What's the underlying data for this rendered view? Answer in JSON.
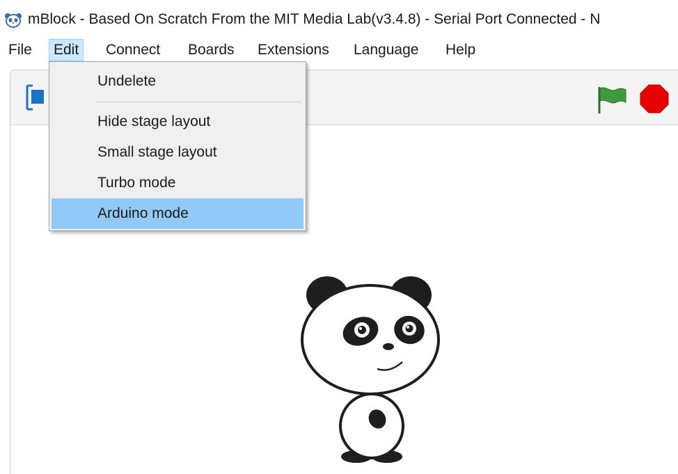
{
  "window": {
    "title": "mBlock - Based On Scratch From the MIT Media Lab(v3.4.8) - Serial Port Connected - N"
  },
  "menubar": {
    "items": [
      {
        "label": "File"
      },
      {
        "label": "Edit"
      },
      {
        "label": "Connect"
      },
      {
        "label": "Boards"
      },
      {
        "label": "Extensions"
      },
      {
        "label": "Language"
      },
      {
        "label": "Help"
      }
    ],
    "open_menu": "Edit"
  },
  "edit_menu": {
    "items": [
      {
        "label": "Undelete"
      },
      {
        "label": "Hide stage layout"
      },
      {
        "label": "Small stage layout"
      },
      {
        "label": "Turbo mode"
      },
      {
        "label": "Arduino mode"
      }
    ],
    "highlighted": "Arduino mode"
  },
  "toolbar": {
    "icons": [
      "stage-layout-toggle-icon",
      "green-flag-icon",
      "stop-sign-icon"
    ]
  },
  "sprite": {
    "icon": "panda-sprite-icon"
  },
  "colors": {
    "menu_open_bg": "#cce8ff",
    "menu_highlight": "#91c9f7",
    "flag_green": "#2e8b2e",
    "stop_red": "#e60000",
    "toggle_blue": "#1a73c9"
  }
}
